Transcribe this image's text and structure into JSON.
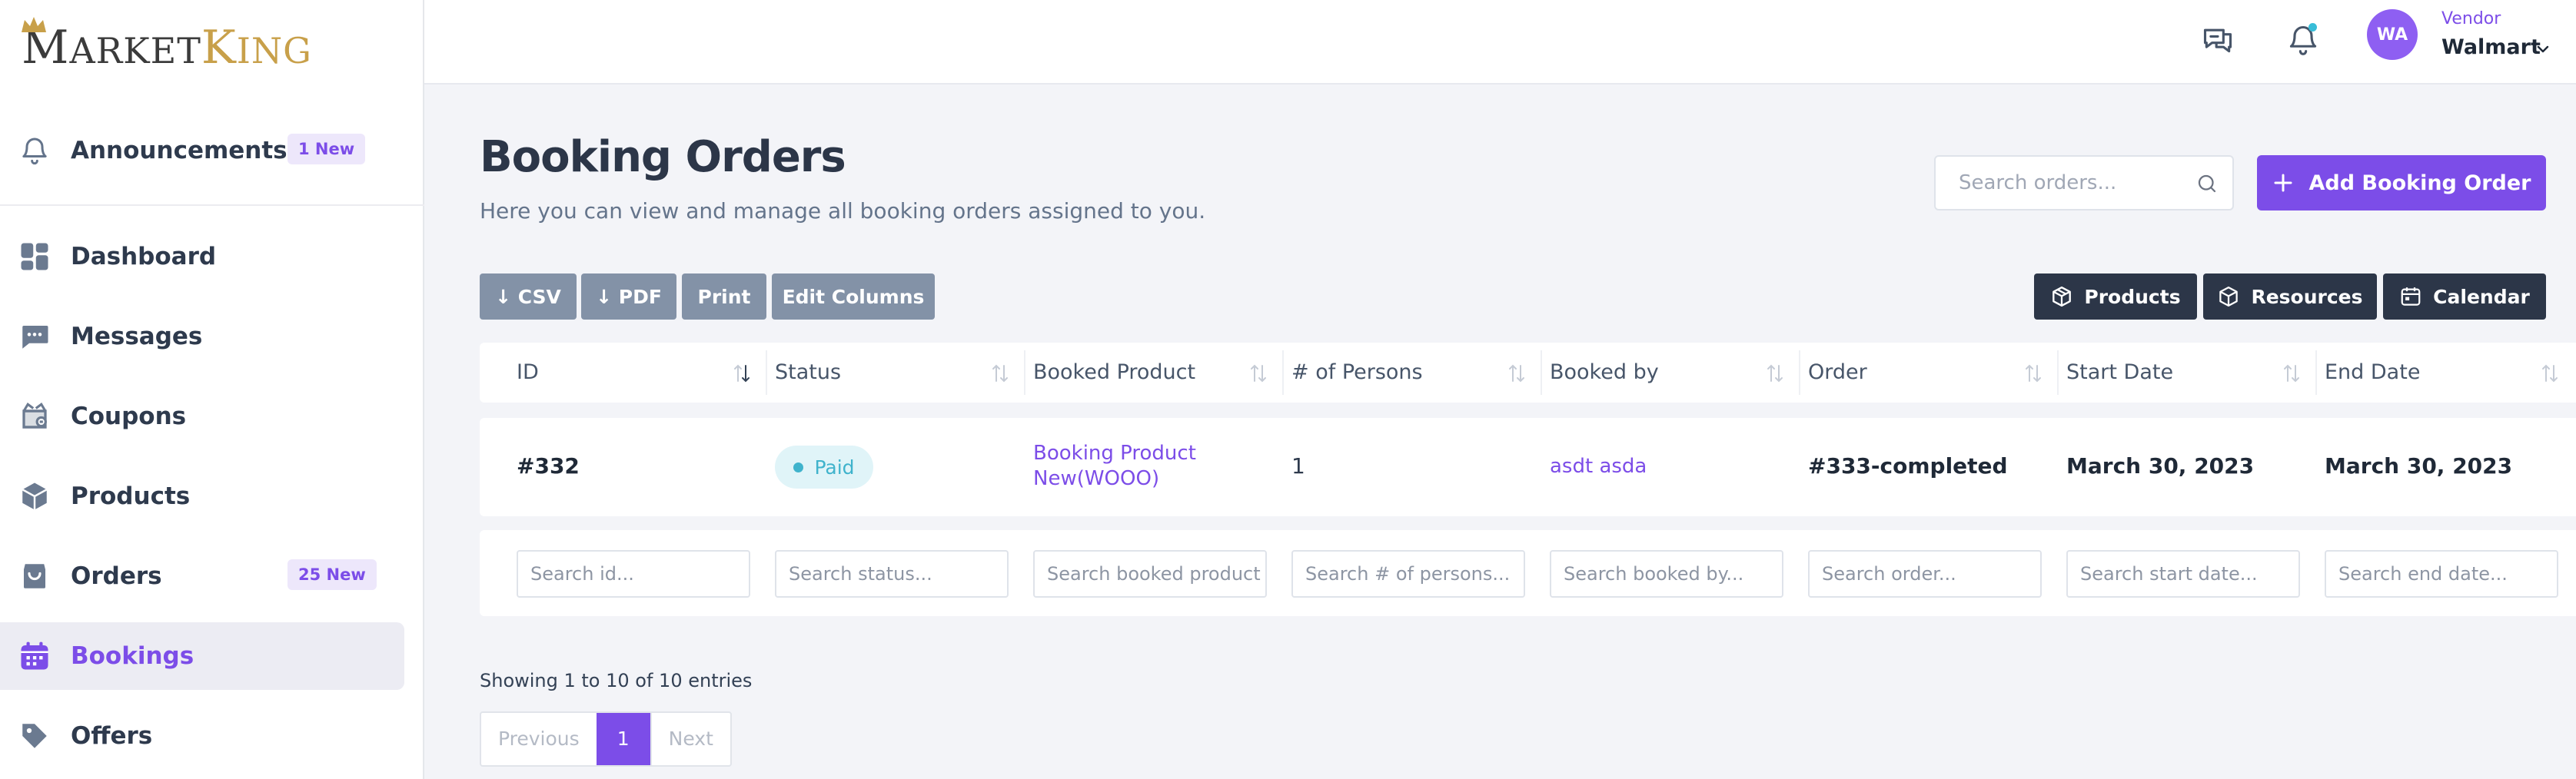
{
  "brand": {
    "part1_cap": "M",
    "part1_rest": "ARKET",
    "part2_cap": "K",
    "part2_rest": "ING"
  },
  "sidebar": {
    "items": [
      {
        "label": "Announcements",
        "badge": "1 New",
        "icon": "bell-icon"
      },
      {
        "label": "Dashboard",
        "badge": "",
        "icon": "dashboard-icon"
      },
      {
        "label": "Messages",
        "badge": "",
        "icon": "messages-icon"
      },
      {
        "label": "Coupons",
        "badge": "",
        "icon": "coupon-icon"
      },
      {
        "label": "Products",
        "badge": "",
        "icon": "box-icon"
      },
      {
        "label": "Orders",
        "badge": "25 New",
        "icon": "bag-icon"
      },
      {
        "label": "Bookings",
        "badge": "",
        "icon": "calendar-icon",
        "active": true
      },
      {
        "label": "Offers",
        "badge": "",
        "icon": "tag-icon"
      }
    ]
  },
  "header": {
    "avatar_initials": "WA",
    "vendor_role": "Vendor",
    "vendor_name": "Walmart"
  },
  "page": {
    "title": "Booking Orders",
    "subtitle": "Here you can view and manage all booking orders assigned to you.",
    "search_placeholder": "Search orders...",
    "add_button": "Add Booking Order"
  },
  "toolbar": {
    "csv": "↓ CSV",
    "pdf": "↓ PDF",
    "print": "Print",
    "edit_columns": "Edit Columns",
    "products": "Products",
    "resources": "Resources",
    "calendar": "Calendar"
  },
  "table": {
    "columns": [
      "ID",
      "Status",
      "Booked Product",
      "# of Persons",
      "Booked by",
      "Order",
      "Start Date",
      "End Date"
    ],
    "rows": [
      {
        "id": "#332",
        "status": "Paid",
        "booked_product_line1": "Booking Product",
        "booked_product_line2": "New(WOOO)",
        "persons": "1",
        "booked_by": "asdt asda",
        "order": "#333-completed",
        "start_date": "March 30, 2023",
        "end_date": "March 30, 2023"
      }
    ],
    "filters": [
      "Search id...",
      "Search status...",
      "Search booked product",
      "Search # of persons...",
      "Search booked by...",
      "Search order...",
      "Search start date...",
      "Search end date..."
    ]
  },
  "footer": {
    "entries": "Showing 1 to 10 of 10 entries",
    "prev": "Previous",
    "current_page": "1",
    "next": "Next"
  },
  "colors": {
    "accent": "#7c4de8",
    "dark_button": "#2c3648",
    "grey_button": "#8392a7",
    "paid_status": "#3fb3cc"
  }
}
